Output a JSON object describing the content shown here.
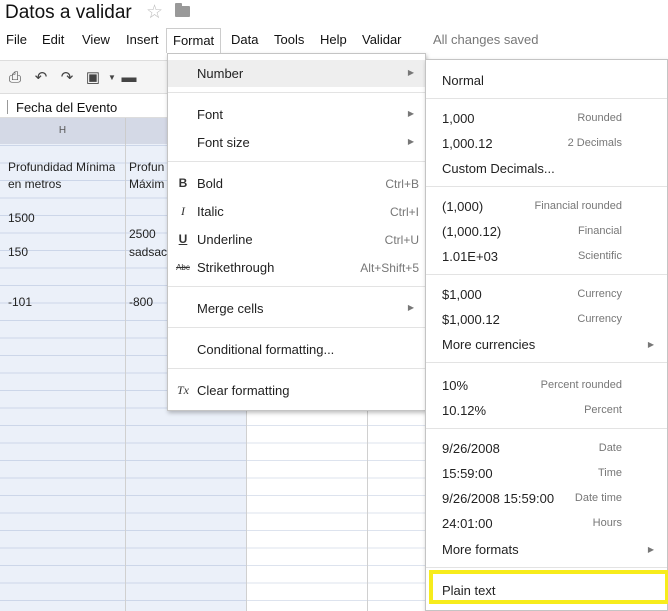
{
  "doc": {
    "title": "Datos a validar",
    "saved_status": "All changes saved"
  },
  "menubar": [
    "File",
    "Edit",
    "View",
    "Insert",
    "Format",
    "Data",
    "Tools",
    "Help",
    "Validar"
  ],
  "formula_bar": {
    "value": "Fecha del Evento"
  },
  "grid": {
    "columns": [
      "H",
      "",
      "",
      "",
      ""
    ],
    "cells": {
      "h_header": [
        "Profundidad Mínima",
        "en metros"
      ],
      "i_header": [
        "Profun",
        "Máxim"
      ],
      "h1": "1500",
      "i1": "2500",
      "h2": "150",
      "i2": "sadsac",
      "h3": "-101",
      "i3": "-800"
    }
  },
  "format_menu": {
    "number": "Number",
    "font": "Font",
    "font_size": "Font size",
    "bold": {
      "label": "Bold",
      "shortcut": "Ctrl+B"
    },
    "italic": {
      "label": "Italic",
      "shortcut": "Ctrl+I"
    },
    "underline": {
      "label": "Underline",
      "shortcut": "Ctrl+U"
    },
    "strikethrough": {
      "label": "Strikethrough",
      "shortcut": "Alt+Shift+5"
    },
    "merge": "Merge cells",
    "conditional": "Conditional formatting...",
    "clear": "Clear formatting",
    "icons": {
      "bold": "B",
      "italic": "I",
      "underline": "U",
      "strike": "Abc",
      "clear": "Tx"
    }
  },
  "number_menu": {
    "normal": "Normal",
    "rounded": {
      "label": "1,000",
      "hint": "Rounded"
    },
    "decimals2": {
      "label": "1,000.12",
      "hint": "2 Decimals"
    },
    "custom_decimals": "Custom Decimals...",
    "financial_rounded": {
      "label": "(1,000)",
      "hint": "Financial rounded"
    },
    "financial": {
      "label": "(1,000.12)",
      "hint": "Financial"
    },
    "scientific": {
      "label": "1.01E+03",
      "hint": "Scientific"
    },
    "currency_rounded": {
      "label": "$1,000",
      "hint": "Currency"
    },
    "currency": {
      "label": "$1,000.12",
      "hint": "Currency"
    },
    "more_currencies": "More currencies",
    "percent_rounded": {
      "label": "10%",
      "hint": "Percent rounded"
    },
    "percent": {
      "label": "10.12%",
      "hint": "Percent"
    },
    "date": {
      "label": "9/26/2008",
      "hint": "Date"
    },
    "time": {
      "label": "15:59:00",
      "hint": "Time"
    },
    "datetime": {
      "label": "9/26/2008 15:59:00",
      "hint": "Date time"
    },
    "hours": {
      "label": "24:01:00",
      "hint": "Hours"
    },
    "more_formats": "More formats",
    "plain_text": "Plain text"
  },
  "colors": {
    "highlight": "#f7ec1c",
    "column_selection": "#dbe3f2"
  }
}
